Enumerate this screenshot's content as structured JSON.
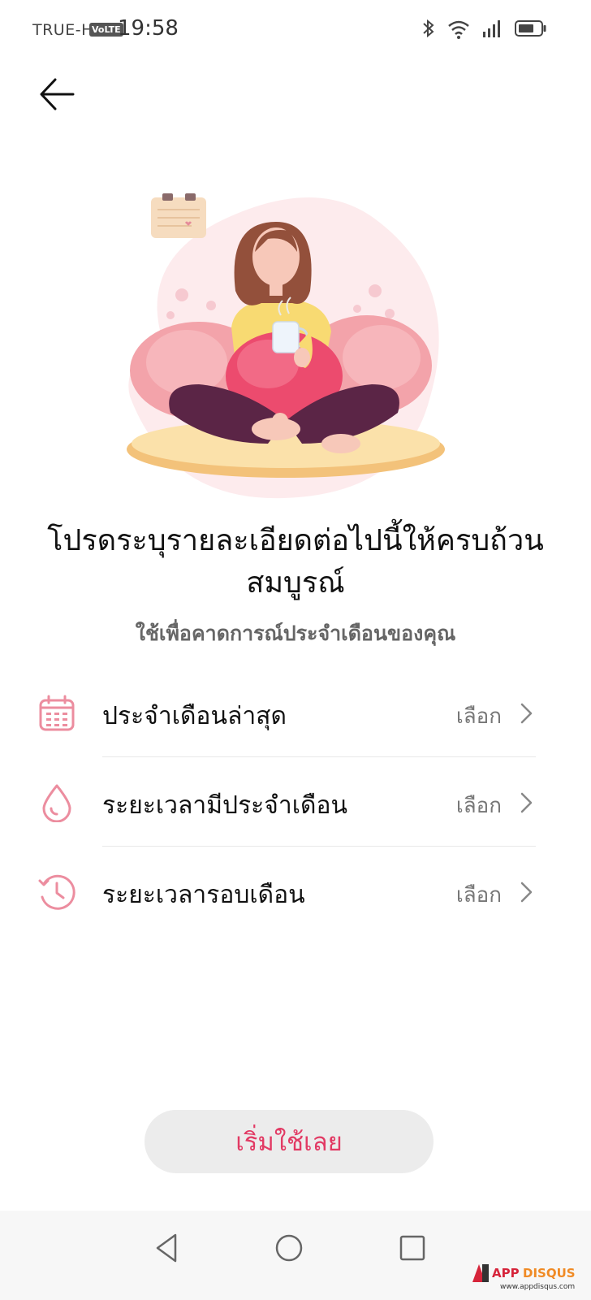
{
  "status_bar": {
    "carrier": "TRUE-H",
    "volte": "VoLTE",
    "time": "19:58"
  },
  "header": {
    "back_icon": "arrow-left-icon"
  },
  "content": {
    "title": "โปรดระบุรายละเอียดต่อไปนี้ให้ครบถ้วนสมบูรณ์",
    "subtitle": "ใช้เพื่อคาดการณ์ประจำเดือนของคุณ"
  },
  "settings": [
    {
      "icon": "calendar-icon",
      "label": "ประจำเดือนล่าสุด",
      "value": "เลือก"
    },
    {
      "icon": "droplet-icon",
      "label": "ระยะเวลามีประจำเดือน",
      "value": "เลือก"
    },
    {
      "icon": "clock-history-icon",
      "label": "ระยะเวลารอบเดือน",
      "value": "เลือก"
    }
  ],
  "start_button": {
    "label": "เริ่มใช้เลย"
  },
  "watermark": {
    "brand": "APPDISQUS",
    "url": "www.appdisqus.com"
  },
  "colors": {
    "accent": "#e23a64",
    "icon_pink": "#ec8d9f",
    "button_bg": "#ececec"
  }
}
